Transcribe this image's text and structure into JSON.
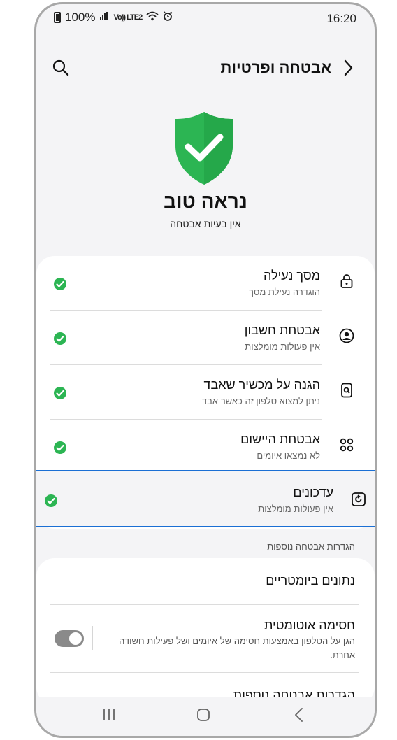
{
  "status_bar": {
    "battery": "100%",
    "signal_text": "Vo)) LTE2",
    "time": "16:20"
  },
  "header": {
    "title": "אבטחה ופרטיות"
  },
  "overview": {
    "status_title": "נראה טוב",
    "status_subtitle": "אין בעיות אבטחה"
  },
  "items": [
    {
      "title": "מסך נעילה",
      "description": "הוגדרה נעילת מסך",
      "icon": "lock-icon",
      "status": "ok"
    },
    {
      "title": "אבטחת חשבון",
      "description": "אין פעולות מומלצות",
      "icon": "account-icon",
      "status": "ok"
    },
    {
      "title": "הגנה על מכשיר שאבד",
      "description": "ניתן למצוא טלפון זה כאשר אבד",
      "icon": "find-device-icon",
      "status": "ok"
    },
    {
      "title": "אבטחת היישום",
      "description": "לא נמצאו איומים",
      "icon": "apps-icon",
      "status": "ok"
    }
  ],
  "updates_item": {
    "title": "עדכונים",
    "description": "אין פעולות מומלצות",
    "icon": "update-icon",
    "status": "ok"
  },
  "more_section": {
    "header": "הגדרות אבטחה נוספות",
    "biometrics_label": "נתונים ביומטריים",
    "auto_blocker_title": "חסימה אוטומטית",
    "auto_blocker_desc": "הגן על הטלפון באמצעות חסימה של איומים ושל פעילות חשודה אחרת.",
    "auto_blocker_enabled": true,
    "more_settings_label": "הגדרות אבטחה נוספות"
  },
  "colors": {
    "accent_green": "#2cb553",
    "highlight_border": "#1a6fd4",
    "background": "#f4f4f6"
  }
}
